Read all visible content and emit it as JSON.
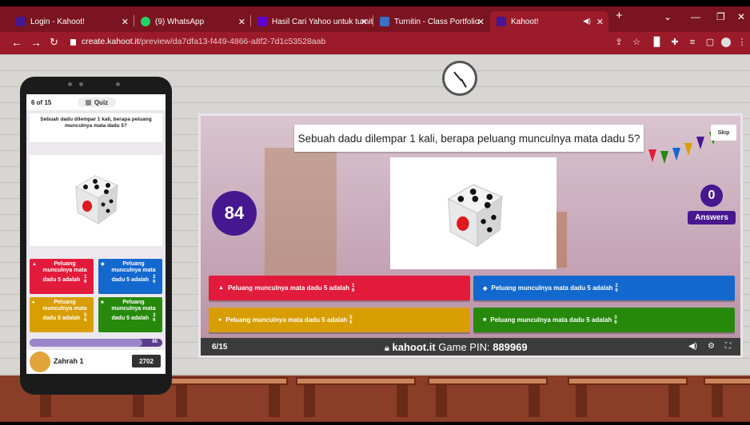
{
  "browser": {
    "tabs": [
      {
        "title": "Login - Kahoot!",
        "close": "✕",
        "color": "#46178f"
      },
      {
        "title": "(9) WhatsApp",
        "close": "✕",
        "color": "#25d366"
      },
      {
        "title": "Hasil Cari Yahoo untuk turnit",
        "close": "✕",
        "color": "#6001d2"
      },
      {
        "title": "Turnitin - Class Portfolio",
        "close": "✕",
        "color": "#3a70c8"
      },
      {
        "title": "Kahoot!",
        "close": "✕",
        "color": "#46178f"
      }
    ],
    "new_tab": "+",
    "url_host": "create.kahoot.it",
    "url_path": "/preview/da7dfa13-f449-4866-a8f2-7d1c53528aab"
  },
  "phone": {
    "counter": "6 of 15",
    "quiz_label": "Quiz",
    "question": "Sebuah dadu dilempar 1 kali, berapa peluang munculnya mata dadu 5?",
    "answers": [
      {
        "text": "Peluang munculnya mata dadu 5 adalah",
        "num": "1",
        "den": "6",
        "color": "red",
        "shape": "▲"
      },
      {
        "text": "Peluang munculnya mata dadu 5 adalah",
        "num": "2",
        "den": "6",
        "color": "blue",
        "shape": "◆"
      },
      {
        "text": "Peluang munculnya mata dadu 5 adalah",
        "num": "5",
        "den": "6",
        "color": "yellow",
        "shape": "●"
      },
      {
        "text": "Peluang munculnya mata dadu 5 adalah",
        "num": "3",
        "den": "6",
        "color": "green",
        "shape": "■"
      }
    ],
    "progress_value": "85",
    "progress_fraction": 0.85,
    "player_name": "Zahrah 1",
    "player_score": "2702"
  },
  "board": {
    "question": "Sebuah dadu dilempar 1 kali, berapa peluang munculnya mata dadu 5?",
    "skip": "Skip",
    "timer": "84",
    "answers_count": "0",
    "answers_label": "Answers",
    "answers": [
      {
        "text": "Peluang munculnya mata dadu 5 adalah",
        "num": "1",
        "den": "6",
        "color": "red",
        "shape": "▲"
      },
      {
        "text": "Peluang munculnya mata dadu 5 adalah",
        "num": "2",
        "den": "6",
        "color": "blue",
        "shape": "◆"
      },
      {
        "text": "Peluang munculnya mata dadu 5 adalah",
        "num": "5",
        "den": "6",
        "color": "yellow",
        "shape": "●"
      },
      {
        "text": "Peluang munculnya mata dadu 5 adalah",
        "num": "3",
        "den": "6",
        "color": "green",
        "shape": "■"
      }
    ],
    "question_counter": "6/15",
    "brand": "kahoot.it",
    "pin_label": "Game PIN:",
    "pin": "889969"
  }
}
